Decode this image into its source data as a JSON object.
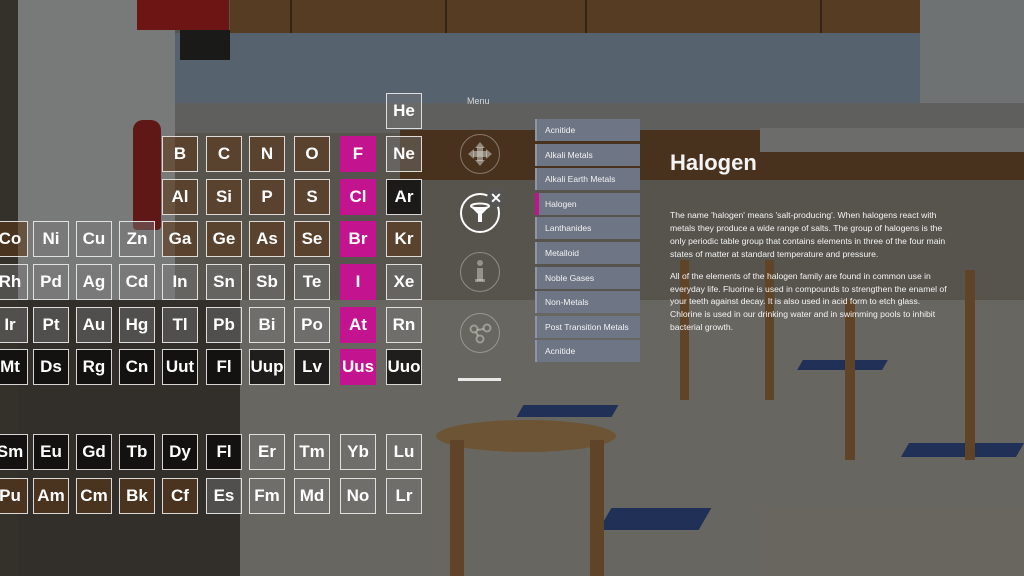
{
  "menu": {
    "label": "Menu",
    "buttons": [
      {
        "name": "move",
        "icon": "move-arrows-icon",
        "active": false
      },
      {
        "name": "filter",
        "icon": "filter-funnel-icon",
        "active": true
      },
      {
        "name": "info",
        "icon": "info-icon",
        "active": false
      },
      {
        "name": "share",
        "icon": "share-nodes-icon",
        "active": false
      }
    ],
    "close_icon": "close-icon"
  },
  "categories": [
    {
      "label": "Acnitide",
      "selected": false
    },
    {
      "label": "Alkali Metals",
      "selected": false
    },
    {
      "label": "Alkali Earth Metals",
      "selected": false
    },
    {
      "label": "Halogen",
      "selected": true
    },
    {
      "label": "Lanthanides",
      "selected": false
    },
    {
      "label": "Metalloid",
      "selected": false
    },
    {
      "label": "Noble Gases",
      "selected": false
    },
    {
      "label": "Non-Metals",
      "selected": false
    },
    {
      "label": "Post Transition Metals",
      "selected": false
    },
    {
      "label": "Acnitide",
      "selected": false
    }
  ],
  "info": {
    "title": "Halogen",
    "paragraph1": "The name 'halogen' means 'salt-producing'. When halogens react with metals they produce a wide range of salts. The group of halogens is the only periodic table group that contains elements in three of the four main states of matter at standard temperature and pressure.",
    "paragraph2": "All of the elements of the halogen family are found in common use in everyday life. Fluorine is used in compounds to strengthen the enamel of your teeth against decay. It is also used in acid form to etch glass. Chlorine is used in our drinking water and in swimming pools to inhibit bacterial growth."
  },
  "accent_color": "#c4138f",
  "table": {
    "main_rows": [
      [
        null,
        null,
        null,
        null,
        null,
        null,
        null,
        null,
        null,
        "He"
      ],
      [
        null,
        null,
        null,
        null,
        "B",
        "C",
        "N",
        "O",
        "F",
        "Ne"
      ],
      [
        null,
        null,
        null,
        null,
        "Al",
        "Si",
        "P",
        "S",
        "Cl",
        "Ar"
      ],
      [
        "Co",
        "Ni",
        "Cu",
        "Zn",
        "Ga",
        "Ge",
        "As",
        "Se",
        "Br",
        "Kr"
      ],
      [
        "Rh",
        "Pd",
        "Ag",
        "Cd",
        "In",
        "Sn",
        "Sb",
        "Te",
        "I",
        "Xe"
      ],
      [
        "Ir",
        "Pt",
        "Au",
        "Hg",
        "Tl",
        "Pb",
        "Bi",
        "Po",
        "At",
        "Rn"
      ],
      [
        "Mt",
        "Ds",
        "Rg",
        "Cn",
        "Uut",
        "Fl",
        "Uup",
        "Lv",
        "Uus",
        "Uuo"
      ]
    ],
    "f_rows": [
      [
        "Sm",
        "Eu",
        "Gd",
        "Tb",
        "Dy",
        "Fl",
        "Er",
        "Tm",
        "Yb",
        "Lu"
      ],
      [
        "Pu",
        "Am",
        "Cm",
        "Bk",
        "Cf",
        "Es",
        "Fm",
        "Md",
        "No",
        "Lr"
      ]
    ],
    "highlighted": [
      "F",
      "Cl",
      "Br",
      "I",
      "At",
      "Uus"
    ]
  }
}
